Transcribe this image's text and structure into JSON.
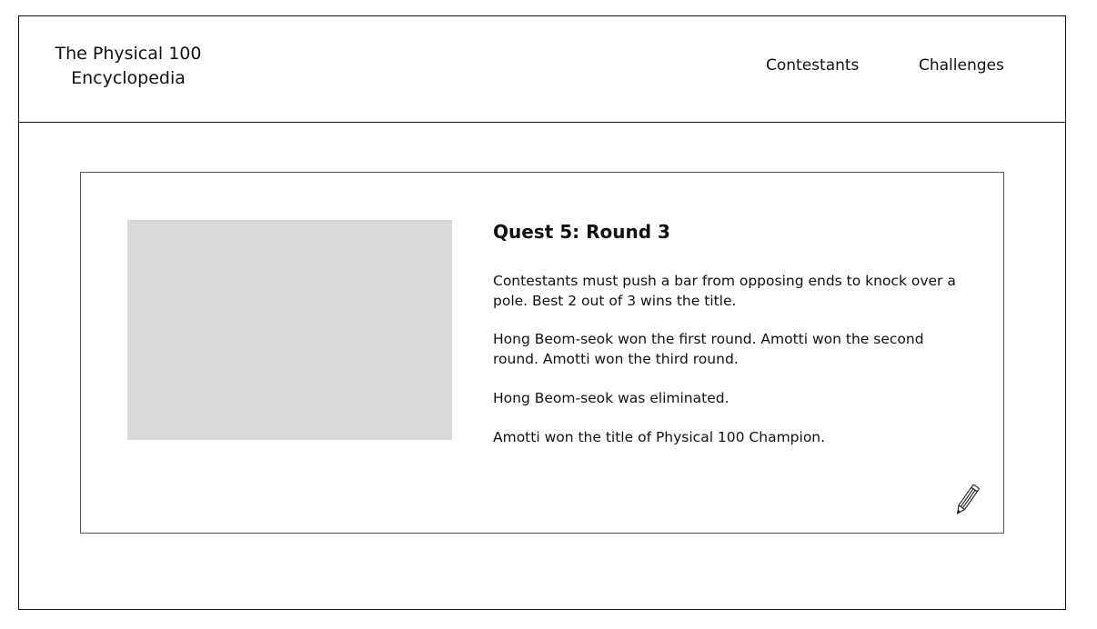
{
  "header": {
    "site_title": "The Physical 100\nEncyclopedia",
    "nav": {
      "contestants": "Contestants",
      "challenges": "Challenges"
    }
  },
  "quest": {
    "image_placeholder_color": "#d9d9d9",
    "title": "Quest 5: Round 3",
    "paragraphs": [
      "Contestants must push a bar from opposing ends to knock over a pole. Best 2 out of 3 wins the title.",
      "Hong Beom-seok won the first round. Amotti won the second round. Amotti won the third round.",
      "Hong Beom-seok was eliminated.",
      "Amotti won the title of Physical 100 Champion."
    ],
    "edit_icon": "pencil-icon"
  }
}
